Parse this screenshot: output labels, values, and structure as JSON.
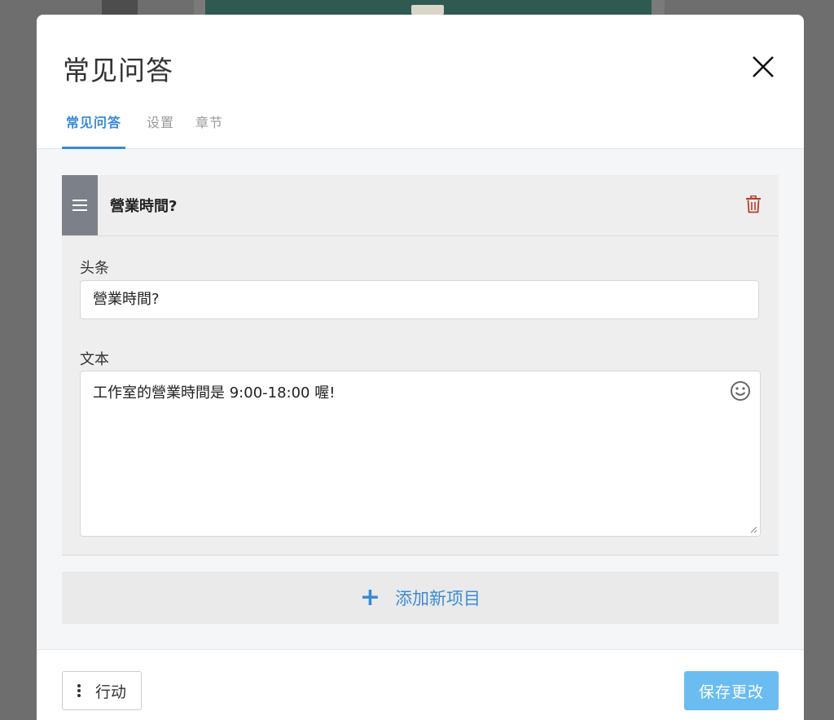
{
  "modal": {
    "title": "常见问答"
  },
  "tabs": [
    {
      "label": "常见问答",
      "active": true
    },
    {
      "label": "设置",
      "active": false
    },
    {
      "label": "章节",
      "active": false
    }
  ],
  "faq_items": [
    {
      "header_title": "營業時間?",
      "headline_label": "头条",
      "headline_value": "營業時間?",
      "text_label": "文本",
      "text_value": "工作室的營業時間是 9:00-18:00 喔!"
    }
  ],
  "add_item_label": "添加新项目",
  "footer": {
    "actions_label": "行动",
    "save_label": "保存更改"
  },
  "colors": {
    "accent": "#3a8ad6",
    "save_button": "#6bbcf0",
    "delete_icon": "#c0392b",
    "drag_handle": "#7c8189"
  },
  "icons": [
    "close-icon",
    "drag-handle-icon",
    "trash-icon",
    "emoji-icon",
    "plus-icon",
    "kebab-icon"
  ]
}
